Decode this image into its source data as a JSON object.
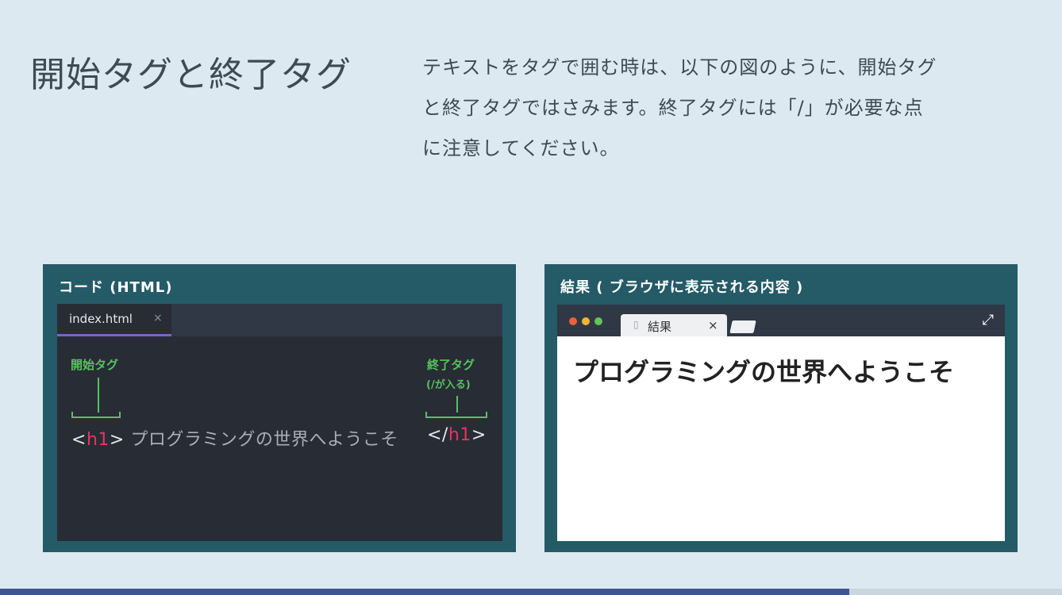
{
  "slide": {
    "title": "開始タグと終了タグ",
    "description_lines": [
      "テキストをタグで囲む時は、以下の図のように、開始タグ",
      "と終了タグではさみます。終了タグには「/」が必要な点",
      "に注意してください。"
    ]
  },
  "code_panel": {
    "title": "コード (HTML)",
    "tab_label": "index.html",
    "tab_close": "×",
    "annotation_open": "開始タグ",
    "annotation_close": "終了タグ",
    "annotation_close_sub": "(/が入る)",
    "code": {
      "open_lt": "<",
      "open_tag": "h1",
      "open_gt": ">",
      "content": "プログラミングの世界へようこそ",
      "close_lt": "</",
      "close_tag": "h1",
      "close_gt": ">"
    }
  },
  "result_panel": {
    "title": "結果 ( ブラウザに表示される内容 )",
    "tab_icon": "document-icon",
    "tab_label": "結果",
    "tab_close": "×",
    "expand_icon": "expand-arrows-icon",
    "heading": "プログラミングの世界へようこそ",
    "window_dots": [
      "#e5633f",
      "#f0b43c",
      "#62c554"
    ]
  },
  "progress": {
    "fraction": 0.8
  },
  "colors": {
    "background": "#dce9f1",
    "panel": "#255a67",
    "editor": "#282c35",
    "tag_accent": "#e8335f",
    "annotation": "#56c25e",
    "tab_underline": "#7b63c7",
    "progress": "#3e5591"
  }
}
